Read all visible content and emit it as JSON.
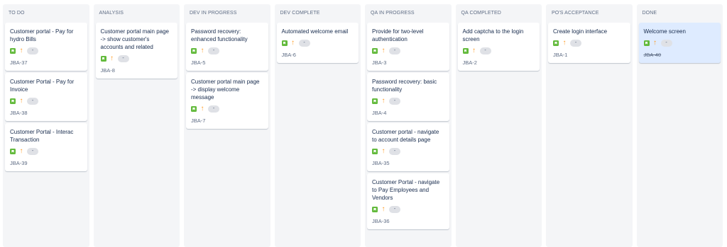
{
  "columns": [
    {
      "title": "TO DO",
      "cards": [
        {
          "title": "Customer portal - Pay for hydro Bills",
          "key": "JBA-37",
          "estimate": "-",
          "done": false
        },
        {
          "title": "Customer Portal - Pay for Invoice",
          "key": "JBA-38",
          "estimate": "-",
          "done": false
        },
        {
          "title": "Customer Portal - Interac Transaction",
          "key": "JBA-39",
          "estimate": "-",
          "done": false
        }
      ]
    },
    {
      "title": "ANALYSIS",
      "cards": [
        {
          "title": "Customer portal main page -> show customer's accounts and related",
          "key": "JBA-8",
          "estimate": "-",
          "done": false
        }
      ]
    },
    {
      "title": "DEV IN PROGRESS",
      "cards": [
        {
          "title": "Password recovery: enhanced functionality",
          "key": "JBA-5",
          "estimate": "-",
          "done": false
        },
        {
          "title": "Customer portal main page -> display welcome message",
          "key": "JBA-7",
          "estimate": "-",
          "done": false
        }
      ]
    },
    {
      "title": "DEV COMPLETE",
      "cards": [
        {
          "title": "Automated welcome email",
          "key": "JBA-6",
          "estimate": "-",
          "done": false
        }
      ]
    },
    {
      "title": "QA IN PROGRESS",
      "cards": [
        {
          "title": "Provide for two-level authentication",
          "key": "JBA-3",
          "estimate": "-",
          "done": false
        },
        {
          "title": "Password recovery: basic functionality",
          "key": "JBA-4",
          "estimate": "-",
          "done": false
        },
        {
          "title": "Customer portal - navigate to account details page",
          "key": "JBA-35",
          "estimate": "-",
          "done": false
        },
        {
          "title": "Customer Portal - navigate to Pay Employees and Vendors",
          "key": "JBA-36",
          "estimate": "-",
          "done": false
        }
      ]
    },
    {
      "title": "QA COMPLETED",
      "cards": [
        {
          "title": "Add captcha to the login screen",
          "key": "JBA-2",
          "estimate": "-",
          "done": false
        }
      ]
    },
    {
      "title": "PO'S ACCEPTANCE",
      "cards": [
        {
          "title": "Create login interface",
          "key": "JBA-1",
          "estimate": "-",
          "done": false
        }
      ]
    },
    {
      "title": "DONE",
      "cards": [
        {
          "title": "Welcome screen",
          "key": "JBA-40",
          "estimate": "-",
          "done": true
        }
      ]
    }
  ],
  "icons": {
    "issue_type": "story-icon",
    "priority": "arrow-up-priority-icon"
  },
  "colors": {
    "story": "#63ba3c",
    "priority": "#ff991f",
    "column_bg": "#f4f5f7",
    "done_card_bg": "#deebff"
  }
}
